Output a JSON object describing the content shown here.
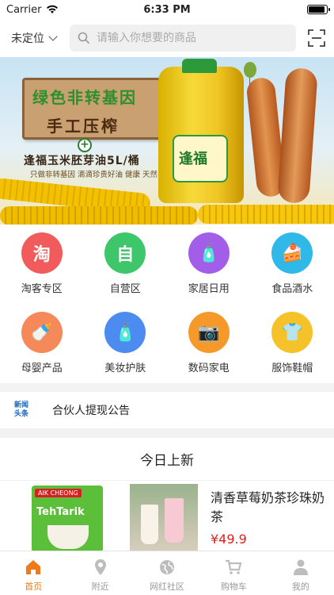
{
  "status_bar": {
    "carrier": "Carrier",
    "time": "6:33 PM",
    "battery_level": 0.95
  },
  "header": {
    "location_label": "未定位",
    "search_placeholder": "请输入你想要的商品"
  },
  "banner": {
    "sign_line1": "绿色非转基因",
    "sign_line2": "手工压榨",
    "product_title": "逢福玉米胚芽油5L/桶",
    "tagline": "只做非转基因 滴滴珍贵好油 健康 天然",
    "brand": "逢福"
  },
  "categories": [
    {
      "label": "淘客专区",
      "glyph": "淘",
      "color": "#f25b5b",
      "icon": "taoke-icon"
    },
    {
      "label": "自营区",
      "glyph": "自",
      "color": "#3dc66a",
      "icon": "self-operated-icon"
    },
    {
      "label": "家居日用",
      "glyph": "🧴",
      "color": "#a25ee8",
      "icon": "household-icon"
    },
    {
      "label": "食品酒水",
      "glyph": "🍰",
      "color": "#2fb8e8",
      "icon": "food-icon"
    },
    {
      "label": "母婴产品",
      "glyph": "🍼",
      "color": "#f6895a",
      "icon": "baby-icon"
    },
    {
      "label": "美妆护肤",
      "glyph": "🧴",
      "color": "#4c8cf0",
      "icon": "cosmetics-icon"
    },
    {
      "label": "数码家电",
      "glyph": "📷",
      "color": "#f59a2a",
      "icon": "digital-icon"
    },
    {
      "label": "服饰鞋帽",
      "glyph": "👕",
      "color": "#f6c22a",
      "icon": "clothing-icon"
    }
  ],
  "news": {
    "tag_line1": "新闻",
    "tag_line2": "头条",
    "text": "合伙人提现公告"
  },
  "today": {
    "title": "今日上新",
    "product1": {
      "logo": "AIK CHEONG",
      "name": "TehTarik"
    },
    "product2": {
      "title": "清香草莓奶茶珍珠奶茶",
      "price": "¥49.9"
    }
  },
  "tabs": [
    {
      "label": "首页",
      "icon": "home-icon",
      "active": true
    },
    {
      "label": "附近",
      "icon": "location-pin-icon",
      "active": false
    },
    {
      "label": "网红社区",
      "icon": "globe-icon",
      "active": false
    },
    {
      "label": "购物车",
      "icon": "cart-icon",
      "active": false
    },
    {
      "label": "我的",
      "icon": "person-icon",
      "active": false
    }
  ],
  "colors": {
    "accent": "#f07a1a",
    "price": "#e02020"
  }
}
